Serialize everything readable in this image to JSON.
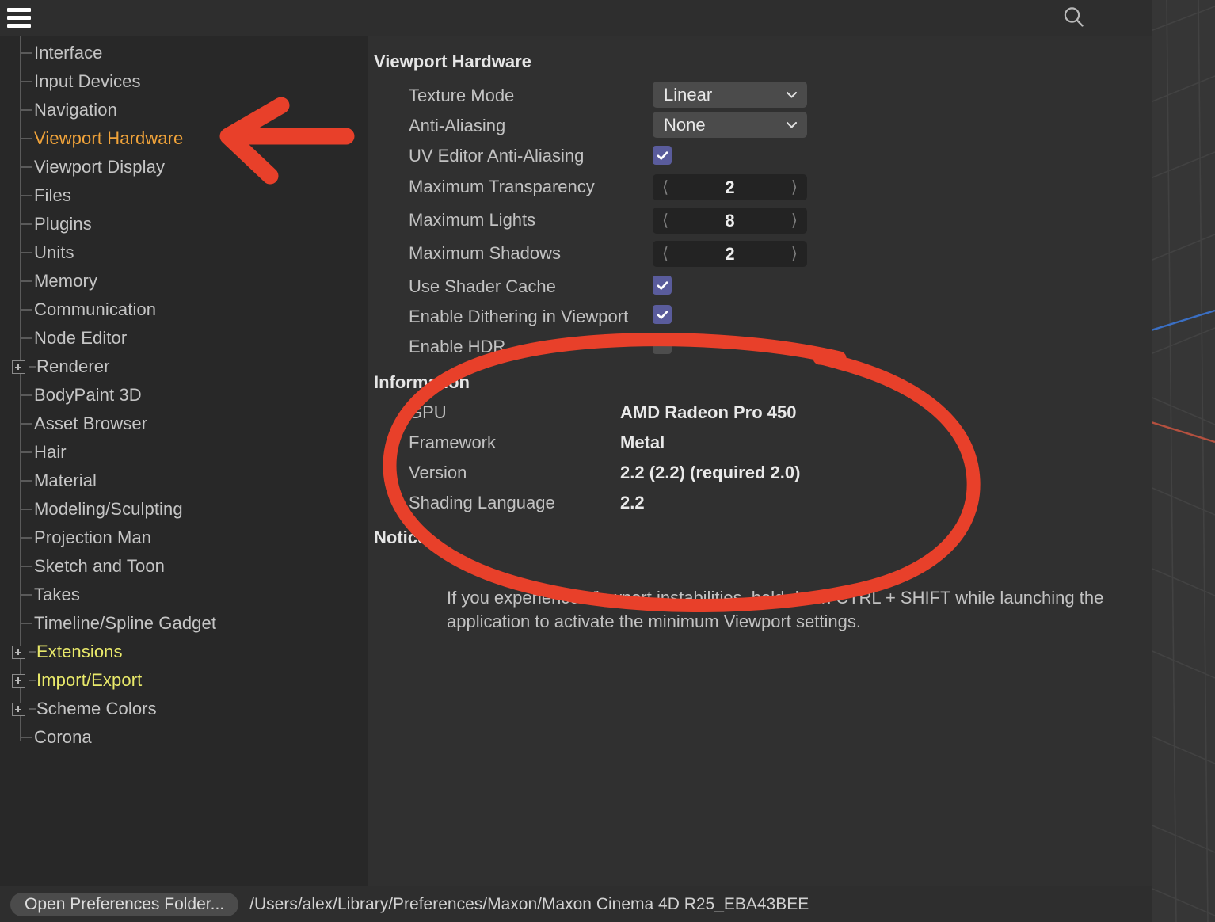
{
  "topbar": {
    "menu_icon": "hamburger-icon",
    "search_icon": "search-icon"
  },
  "sidebar": {
    "items": [
      {
        "label": "Interface",
        "expandable": false,
        "state": "normal"
      },
      {
        "label": "Input Devices",
        "expandable": false,
        "state": "normal"
      },
      {
        "label": "Navigation",
        "expandable": false,
        "state": "normal"
      },
      {
        "label": "Viewport Hardware",
        "expandable": false,
        "state": "selected"
      },
      {
        "label": "Viewport Display",
        "expandable": false,
        "state": "normal"
      },
      {
        "label": "Files",
        "expandable": false,
        "state": "normal"
      },
      {
        "label": "Plugins",
        "expandable": false,
        "state": "normal"
      },
      {
        "label": "Units",
        "expandable": false,
        "state": "normal"
      },
      {
        "label": "Memory",
        "expandable": false,
        "state": "normal"
      },
      {
        "label": "Communication",
        "expandable": false,
        "state": "normal"
      },
      {
        "label": "Node Editor",
        "expandable": false,
        "state": "normal"
      },
      {
        "label": "Renderer",
        "expandable": true,
        "state": "normal"
      },
      {
        "label": "BodyPaint 3D",
        "expandable": false,
        "state": "normal"
      },
      {
        "label": "Asset Browser",
        "expandable": false,
        "state": "normal"
      },
      {
        "label": "Hair",
        "expandable": false,
        "state": "normal"
      },
      {
        "label": "Material",
        "expandable": false,
        "state": "normal"
      },
      {
        "label": "Modeling/Sculpting",
        "expandable": false,
        "state": "normal"
      },
      {
        "label": "Projection Man",
        "expandable": false,
        "state": "normal"
      },
      {
        "label": "Sketch and Toon",
        "expandable": false,
        "state": "normal"
      },
      {
        "label": "Takes",
        "expandable": false,
        "state": "normal"
      },
      {
        "label": "Timeline/Spline Gadget",
        "expandable": false,
        "state": "normal"
      },
      {
        "label": "Extensions",
        "expandable": true,
        "state": "highlight"
      },
      {
        "label": "Import/Export",
        "expandable": true,
        "state": "highlight"
      },
      {
        "label": "Scheme Colors",
        "expandable": true,
        "state": "normal"
      },
      {
        "label": "Corona",
        "expandable": false,
        "state": "normal"
      }
    ],
    "selected_color": "#f0a33a",
    "highlight_color": "#e9e96a"
  },
  "main": {
    "section_hardware_title": "Viewport Hardware",
    "properties": [
      {
        "label": "Texture Mode",
        "control": "dropdown",
        "value": "Linear"
      },
      {
        "label": "Anti-Aliasing",
        "control": "dropdown",
        "value": "None"
      },
      {
        "label": "UV Editor Anti-Aliasing",
        "control": "checkbox",
        "value": "checked"
      },
      {
        "label": "Maximum Transparency",
        "control": "stepper",
        "value": "2"
      },
      {
        "label": "Maximum Lights",
        "control": "stepper",
        "value": "8"
      },
      {
        "label": "Maximum Shadows",
        "control": "stepper",
        "value": "2"
      },
      {
        "label": "Use Shader Cache",
        "control": "checkbox",
        "value": "checked"
      },
      {
        "label": "Enable Dithering in Viewport",
        "control": "checkbox",
        "value": "checked"
      },
      {
        "label": "Enable HDR",
        "control": "checkbox",
        "value": "unchecked"
      }
    ],
    "section_information_title": "Information",
    "information": [
      {
        "key": "GPU",
        "value": "AMD Radeon Pro 450"
      },
      {
        "key": "Framework",
        "value": "Metal"
      },
      {
        "key": "Version",
        "value": "2.2 (2.2) (required 2.0)"
      },
      {
        "key": "Shading Language",
        "value": "2.2"
      }
    ],
    "section_notice_title": "Notice",
    "notice_text": "If you experience Viewport instabilities, hold down CTRL + SHIFT while launching the application to activate the minimum Viewport settings."
  },
  "bottombar": {
    "open_folder_label": "Open Preferences Folder...",
    "prefs_path": "/Users/alex/Library/Preferences/Maxon/Maxon Cinema 4D R25_EBA43BEE"
  },
  "annotations": {
    "arrow_color": "#e8402a",
    "circle_color": "#e8402a",
    "arrow_name": "red-arrow-pointing-to-viewport-hardware",
    "circle_name": "red-ellipse-around-information-block"
  },
  "viewport": {
    "axis_x_color": "#b4503f",
    "axis_z_color": "#3a6fc4",
    "grid_color": "#424242",
    "background": "#363636"
  }
}
